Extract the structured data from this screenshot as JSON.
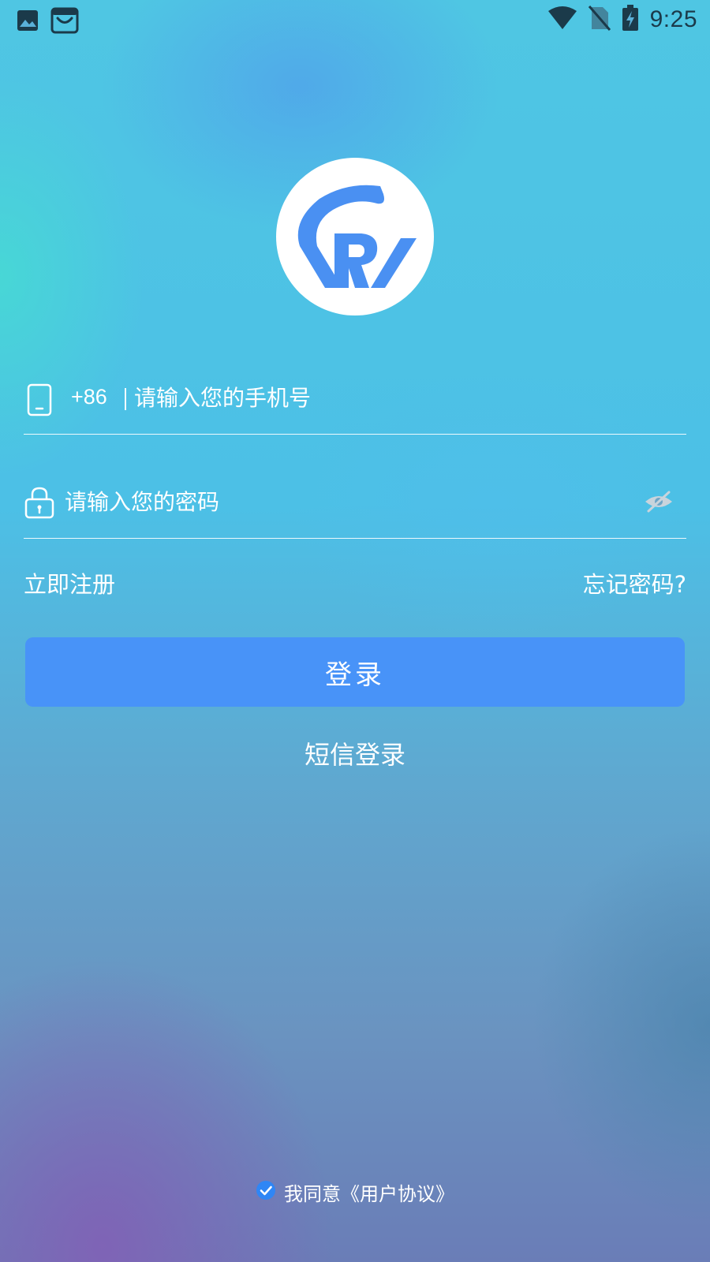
{
  "status_bar": {
    "time": "9:25",
    "left_icons": [
      "gallery-icon",
      "shopping-bag-icon"
    ],
    "right_icons": [
      "wifi-icon",
      "no-sim-icon",
      "battery-charging-icon"
    ],
    "icon_color": "#1b3a4a"
  },
  "logo": {
    "brand_color": "#4a90f2",
    "background": "#ffffff"
  },
  "phone_field": {
    "country_code": "+86",
    "placeholder": "请输入您的手机号",
    "value": ""
  },
  "password_field": {
    "placeholder": "请输入您的密码",
    "value": "",
    "visibility_icon": "eye-off-icon"
  },
  "links": {
    "register": "立即注册",
    "forgot_password": "忘记密码?"
  },
  "login_button": {
    "label": "登录",
    "color": "#4893f8"
  },
  "sms_login": {
    "label": "短信登录"
  },
  "agreement": {
    "checked": true,
    "prefix": "我同意",
    "link_text": "《用户协议》",
    "check_color": "#2f86f5"
  }
}
